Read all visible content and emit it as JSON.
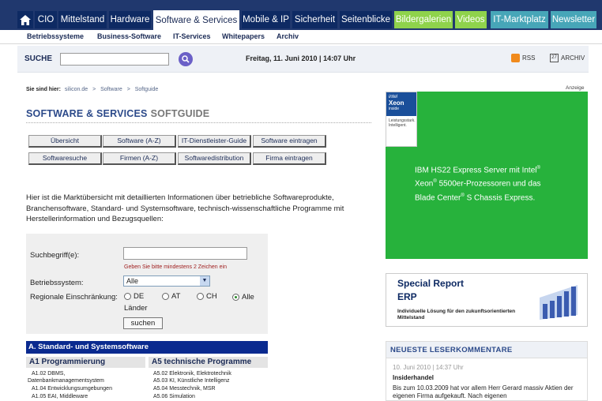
{
  "topnav": {
    "tabs": [
      "CIO",
      "Mittelstand",
      "Hardware",
      "Software & Services",
      "Mobile & IP",
      "Sicherheit",
      "Seitenblicke",
      "Bildergalerien",
      "Videos",
      "IT-Marktplatz",
      "Newsletter"
    ],
    "active": "Software & Services"
  },
  "subnav": [
    "Betriebssysteme",
    "Business-Software",
    "IT-Services",
    "Whitepapers",
    "Archiv"
  ],
  "searchbar": {
    "label": "SUCHE",
    "date": "Freitag, 11. Juni 2010 | 14:07 Uhr",
    "rss": "RSS",
    "archive": "ARCHIV",
    "archive_icon_text": "27"
  },
  "breadcrumb": {
    "prefix": "Sie sind hier:",
    "items": [
      "silicon.de",
      "Software",
      "Softguide"
    ],
    "sep": ">"
  },
  "page": {
    "title_a": "SOFTWARE & SERVICES",
    "title_b": "SOFTGUIDE"
  },
  "buttons": [
    "Übersicht",
    "Software (A-Z)",
    "IT-Dienstleister-Guide",
    "Software eintragen",
    "Softwaresuche",
    "Firmen (A-Z)",
    "Softwaredistribution",
    "Firma eintragen"
  ],
  "intro": "Hier ist die Marktübersicht mit detaillierten Informationen über betriebliche Softwareprodukte, Branchensoftware, Standard- und Systemsoftware, technisch-wissenschaftliche Programme mit Herstellerinformation und Bezugsquellen:",
  "form": {
    "search_label": "Suchbegriff(e):",
    "search_value": "",
    "hint": "Geben Sie bitte mindestens 2 Zeichen ein",
    "os_label": "Betriebssystem:",
    "os_value": "Alle",
    "region_label": "Regionale Einschränkung:",
    "regions": [
      "DE",
      "AT",
      "CH",
      "Alle Länder"
    ],
    "selected_region": "Alle Länder",
    "submit": "suchen"
  },
  "category": {
    "title": "A. Standard- und Systemsoftware",
    "col1": {
      "head": "A1 Programmierung",
      "items": [
        "A1.02 DBMS,",
        "Datenbankmanagementsystem",
        "A1.04 Entwicklungsumgebungen",
        "A1.05 EAI, Middleware"
      ]
    },
    "col2": {
      "head": "A5 technische Programme",
      "items": [
        "A5.02 Elektronik, Elektrotechnik",
        "A5.03 KI, Künstliche Intelligenz",
        "A5.04 Messtechnik, MSR",
        "A5.06 Simulation"
      ]
    }
  },
  "ads": {
    "label": "Anzeige",
    "chip_brand": "intel",
    "chip_model": "Xeon",
    "chip_inside": "inside",
    "chip_tag": "Leistungsstark. Intelligent.",
    "big_line1": "IBM HS22 Express Server mit Intel",
    "big_line2": "Xeon",
    "big_line2b": "5500er-Prozessoren und das",
    "big_line3": "Blade Center",
    "big_line3b": "S Chassis Express.",
    "reg": "®",
    "special_title": "Special Report",
    "special_topic": "ERP",
    "special_sub": "Individuelle Lösung für den zukunftsorientierten Mittelstand"
  },
  "comments": {
    "head": "NEUESTE LESERKOMMENTARE",
    "date": "10. Juni 2010 | 14:37 Uhr",
    "title": "Insiderhandel",
    "text": "Bis zum 10.03.2009 hat vor allem Herr Gerard massiv Aktien der eigenen Firma aufgekauft. Nach eigenen"
  },
  "colors": {
    "nav": "#0e2a63",
    "green_tab": "#8fd34c",
    "teal_tab": "#47a6b8",
    "ad_green": "#27b23c",
    "cat_blue": "#0a2a8f"
  }
}
